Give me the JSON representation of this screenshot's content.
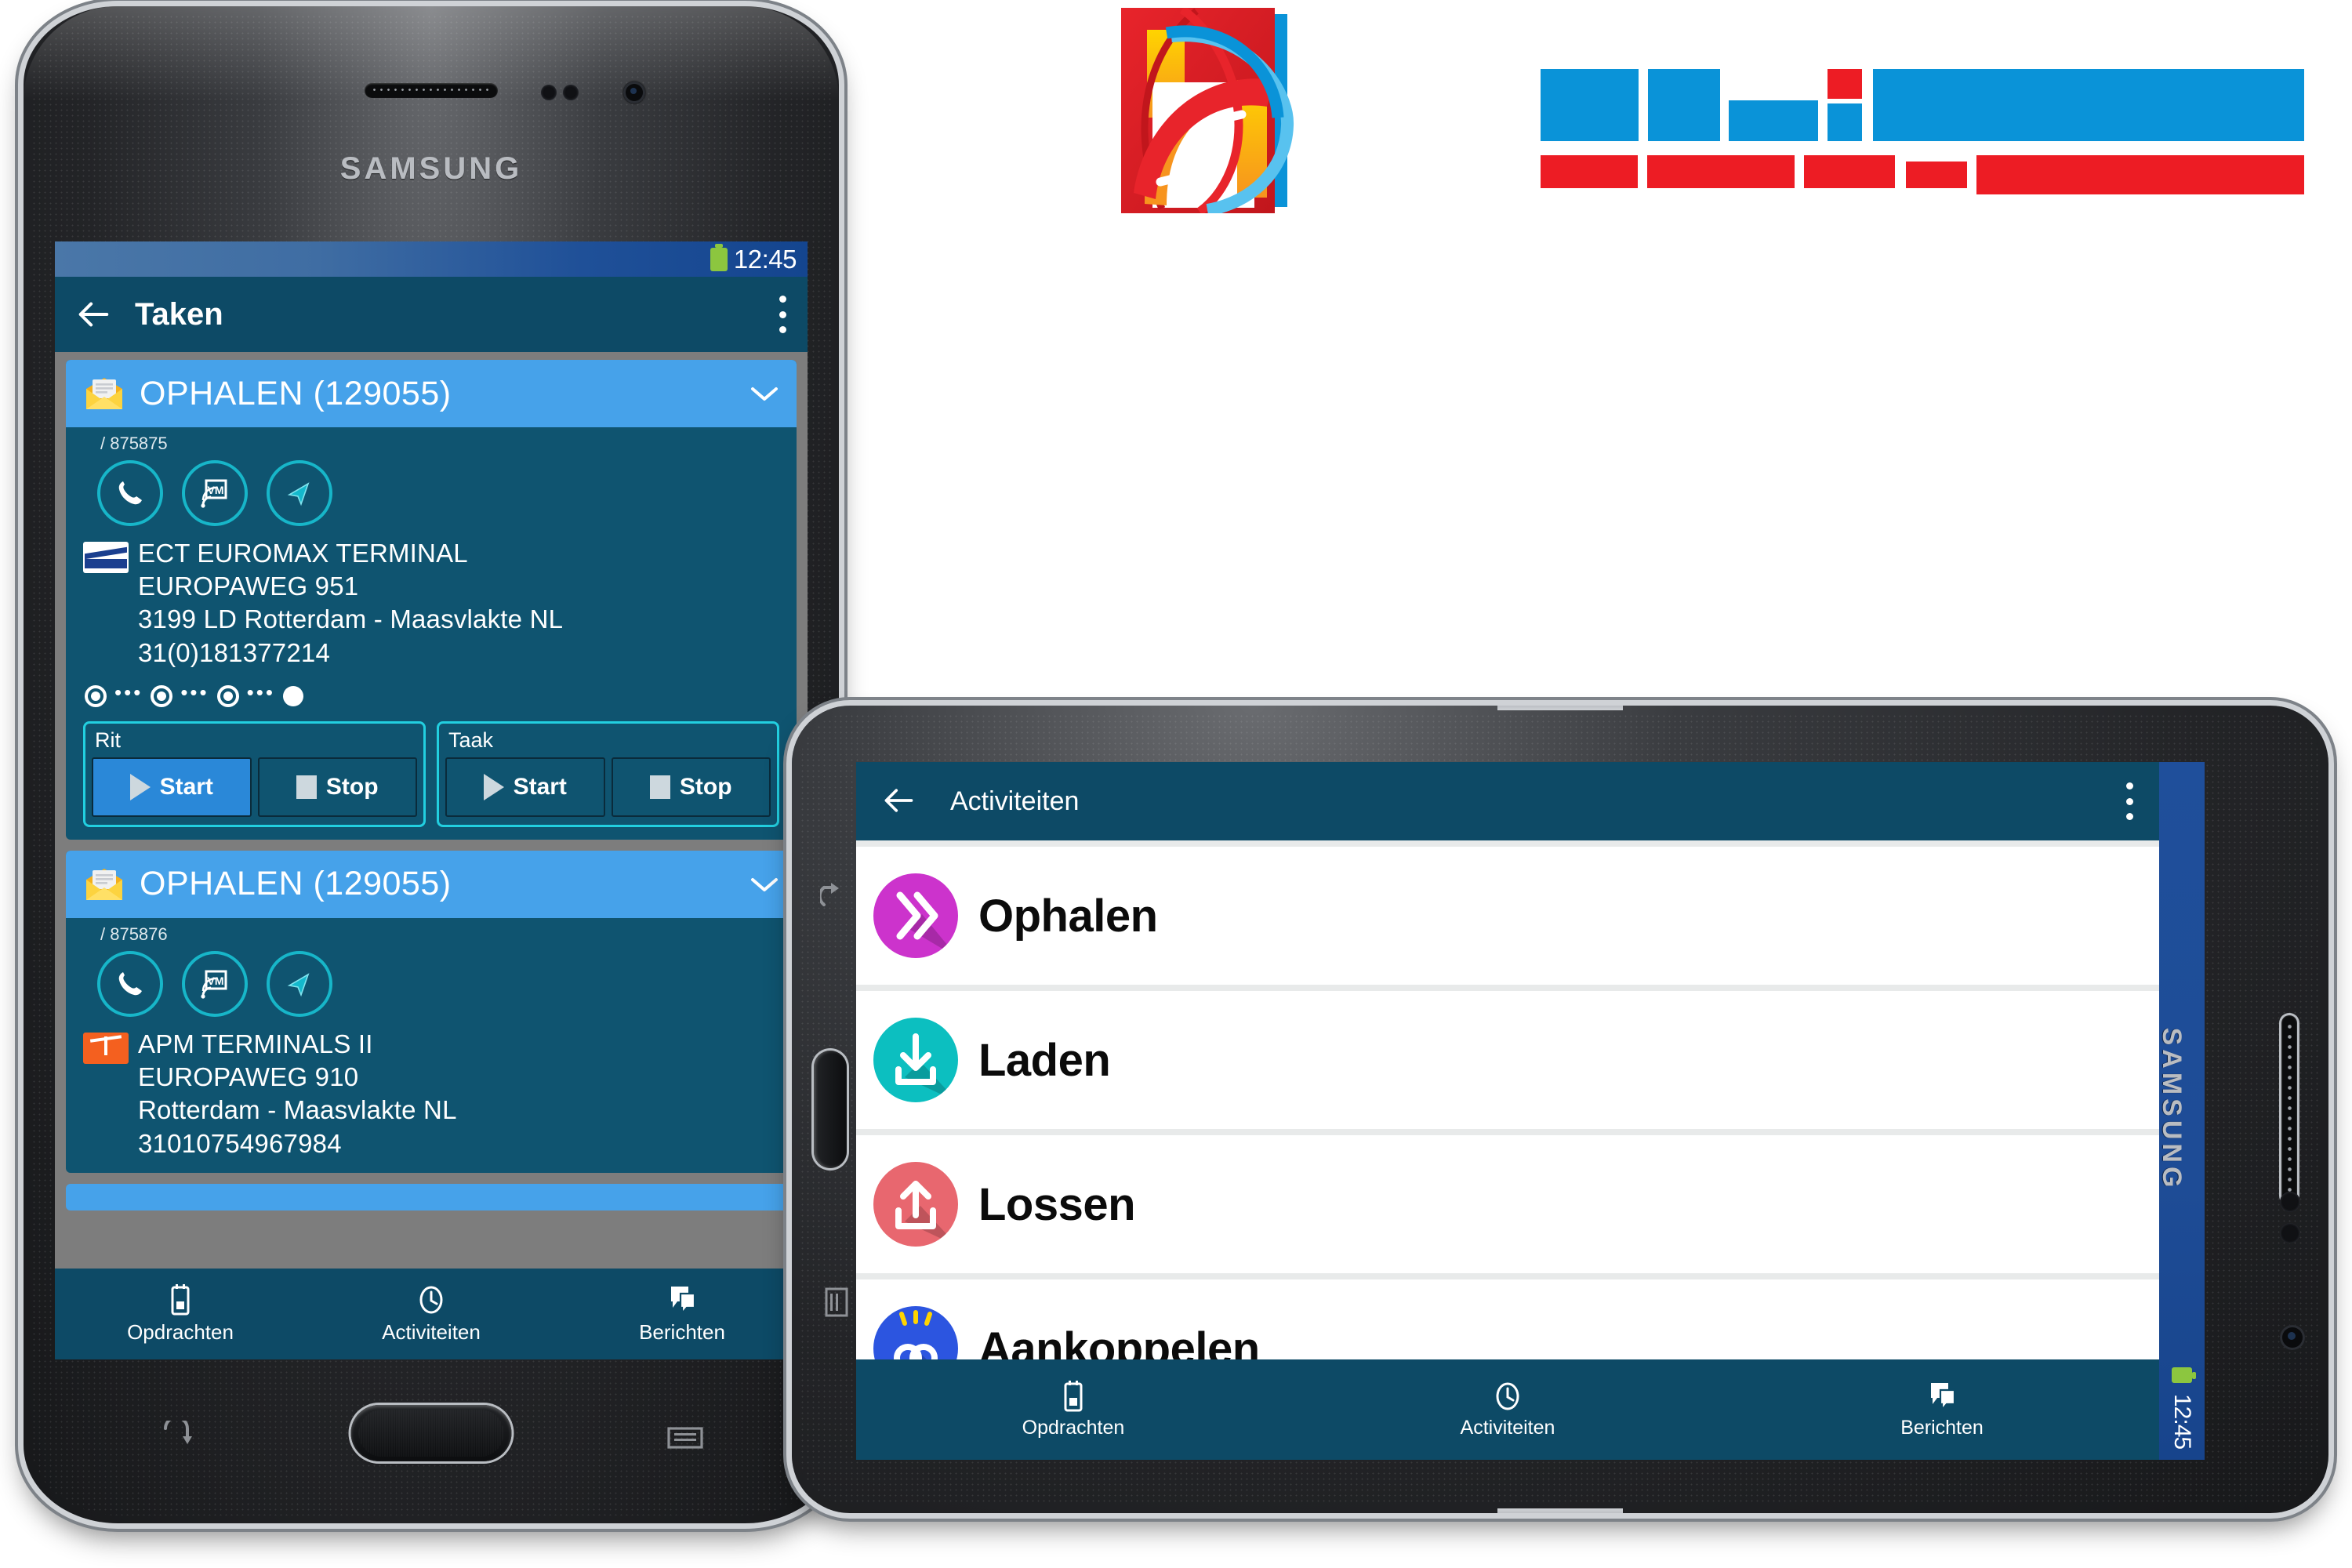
{
  "phone": {
    "device_brand": "SAMSUNG",
    "status_bar": {
      "time": "12:45",
      "battery_icon": "battery-icon"
    },
    "app_bar": {
      "back_icon": "arrow-back-icon",
      "title": "Taken",
      "overflow_icon": "kebab-menu-icon"
    },
    "tasks": [
      {
        "header_label": "OPHALEN  (129055)",
        "header_icon": "mail-open-icon",
        "expand_icon": "chevron-down-icon",
        "sub_reference": "/ 875875",
        "actions": [
          {
            "name": "call-action",
            "icon": "phone-icon"
          },
          {
            "name": "voicemail-action",
            "icon": "vm-broadcast-icon"
          },
          {
            "name": "navigate-action",
            "icon": "navigation-arrow-icon"
          }
        ],
        "terminal_logo": "ect-rotterdam-logo",
        "address": [
          "ECT EUROMAX TERMINAL",
          "EUROPAWEG 951",
          "3199 LD Rotterdam - Maasvlakte NL",
          "31(0)181377214"
        ],
        "progress_steps": 4,
        "progress_completed": 3,
        "controls": [
          {
            "label": "Rit",
            "start": "Start",
            "stop": "Stop",
            "start_active": true
          },
          {
            "label": "Taak",
            "start": "Start",
            "stop": "Stop",
            "start_active": false
          }
        ]
      },
      {
        "header_label": "OPHALEN  (129055)",
        "header_icon": "mail-open-icon",
        "expand_icon": "chevron-down-icon",
        "sub_reference": "/ 875876",
        "actions": [
          {
            "name": "call-action",
            "icon": "phone-icon"
          },
          {
            "name": "voicemail-action",
            "icon": "vm-broadcast-icon"
          },
          {
            "name": "navigate-action",
            "icon": "navigation-arrow-icon"
          }
        ],
        "terminal_logo": "apm-terminals-logo",
        "address": [
          "APM TERMINALS II",
          "EUROPAWEG  910",
          " Rotterdam - Maasvlakte NL",
          "31010754967984"
        ]
      }
    ],
    "bottom_nav": [
      {
        "label": "Opdrachten",
        "icon": "clipboard-device-icon"
      },
      {
        "label": "Activiteiten",
        "icon": "clock-icon"
      },
      {
        "label": "Berichten",
        "icon": "messages-icon"
      }
    ],
    "hardware": {
      "back_key_icon": "back-arrow-key-icon",
      "menu_key_icon": "recents-key-icon"
    }
  },
  "tablet": {
    "device_brand": "SAMSUNG",
    "status_bar": {
      "time": "12:45",
      "battery_icon": "battery-icon"
    },
    "app_bar": {
      "back_icon": "arrow-back-icon",
      "title": "Activiteiten",
      "overflow_icon": "kebab-menu-icon"
    },
    "activities": [
      {
        "label": "Ophalen",
        "icon": "double-chevron-right-icon",
        "color": "#cc33cc"
      },
      {
        "label": "Laden",
        "icon": "download-tray-icon",
        "color": "#0cbfc0"
      },
      {
        "label": "Lossen",
        "icon": "upload-tray-icon",
        "color": "#e8676f"
      },
      {
        "label": "Aankoppelen",
        "icon": "chain-link-icon",
        "color": "#2c55e0"
      }
    ],
    "bottom_nav": [
      {
        "label": "Opdrachten",
        "icon": "clipboard-device-icon"
      },
      {
        "label": "Activiteiten",
        "icon": "clock-icon"
      },
      {
        "label": "Berichten",
        "icon": "messages-icon"
      }
    ],
    "hardware": {
      "back_key_icon": "back-arrow-key-icon",
      "menu_key_icon": "recents-key-icon"
    }
  },
  "logo": {
    "name": "company-logo",
    "mark_description": "red-square-with-blue-swoosh-and-road",
    "wordmark_redacted": true,
    "colors": {
      "blue": "#0a93d8",
      "red": "#ed1c24",
      "yellow": "#ffd400",
      "light_blue": "#58c2ef"
    }
  },
  "theme": {
    "app_bar_blue": "#0d4a66",
    "card_body_blue": "#0f5470",
    "card_header_blue": "#46a2ea",
    "accent_cyan": "#22cfe0",
    "active_button_blue": "#2a88d8",
    "status_bar_blue": "#1f5098",
    "battery_green": "#8cc63f"
  }
}
